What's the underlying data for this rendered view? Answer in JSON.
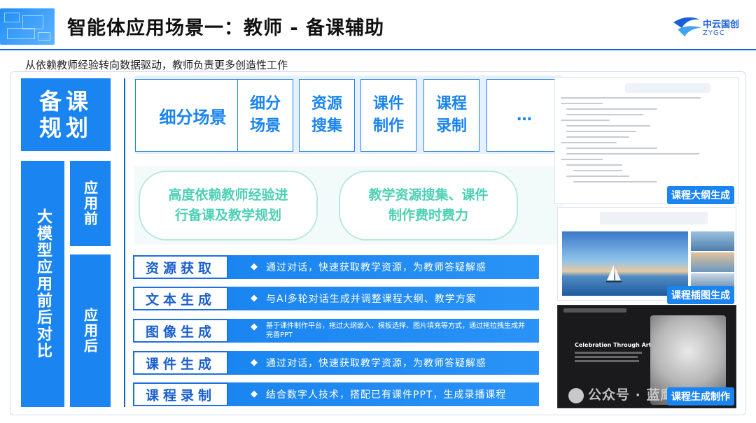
{
  "header": {
    "title": "智能体应用场景一：教师 - 备课辅助",
    "subtitle": "从依赖教师经验转向数据驱动，教师负责更多创造性工作",
    "logo_text": "中云国创",
    "logo_sub": "ZYGC"
  },
  "left": {
    "plan_label": "备课\n规划",
    "compare_label": "大模型应用前后对比",
    "before_label": "应用前",
    "after_label": "应用后"
  },
  "scenarios": [
    "细分场景",
    "细分\n场景",
    "资源\n搜集",
    "课件\n制作",
    "课程\n录制",
    "…"
  ],
  "pain_points": [
    "高度依赖教师经验进\n行备课及教学规划",
    "教学资源搜集、课件\n制作费时费力"
  ],
  "rows": [
    {
      "label": "资源获取",
      "text": "通过对话，快速获取教学资源，为教师答疑解惑"
    },
    {
      "label": "文本生成",
      "text": "与AI多轮对话生成并调整课程大纲、教学方案"
    },
    {
      "label": "图像生成",
      "text": "基于课件制作平台，拖过大纲嵌入、模板选择、图片填充等方式，通过拖拉拽生成并完善PPT"
    },
    {
      "label": "课件生成",
      "text": "通过对话，快速获取教学资源，为教师答疑解惑"
    },
    {
      "label": "课程录制",
      "text": "结合数字人技术，搭配已有课件PPT，生成录播课程"
    }
  ],
  "screenshots": {
    "outline_caption": "课程大纲生成",
    "image_caption": "课程插图生成",
    "video_caption": "课程生成制作",
    "video_slide_title": "Celebration Through Art"
  },
  "watermark": "公众号 · 蓝鹰Lab",
  "colors": {
    "primary": "#1a84f0",
    "accent_green": "#4ed0b4",
    "dark_blue": "#1b5fd8"
  }
}
